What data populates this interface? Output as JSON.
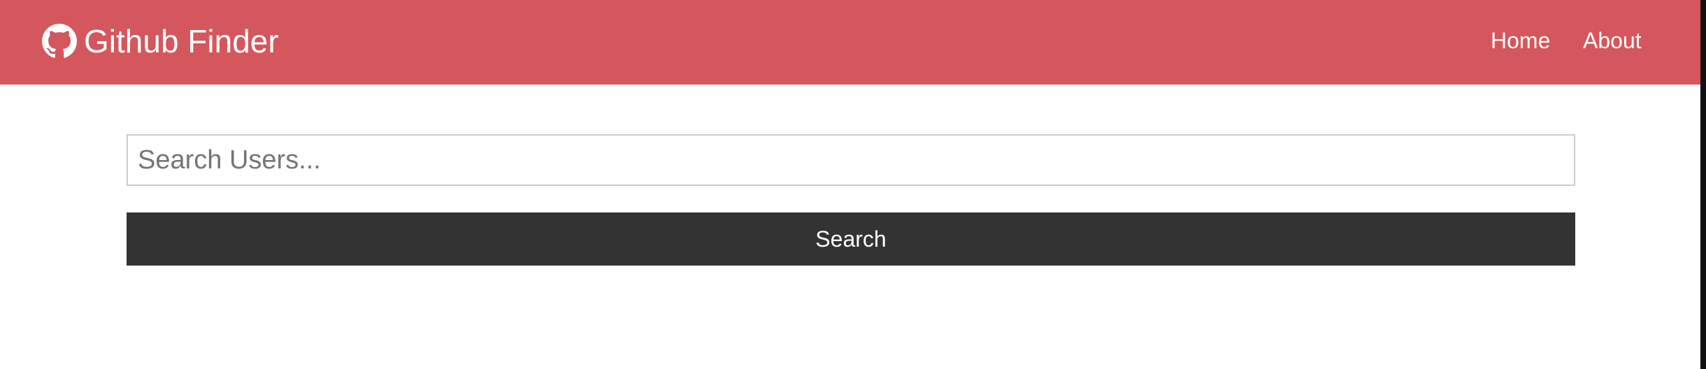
{
  "app": {
    "brand_title": "Github Finder",
    "brand_icon": "github-icon",
    "accent_color": "#d4575d"
  },
  "nav": {
    "links": [
      {
        "label": "Home"
      },
      {
        "label": "About"
      }
    ]
  },
  "search": {
    "placeholder": "Search Users...",
    "value": "",
    "button_label": "Search",
    "button_color": "#333333"
  }
}
